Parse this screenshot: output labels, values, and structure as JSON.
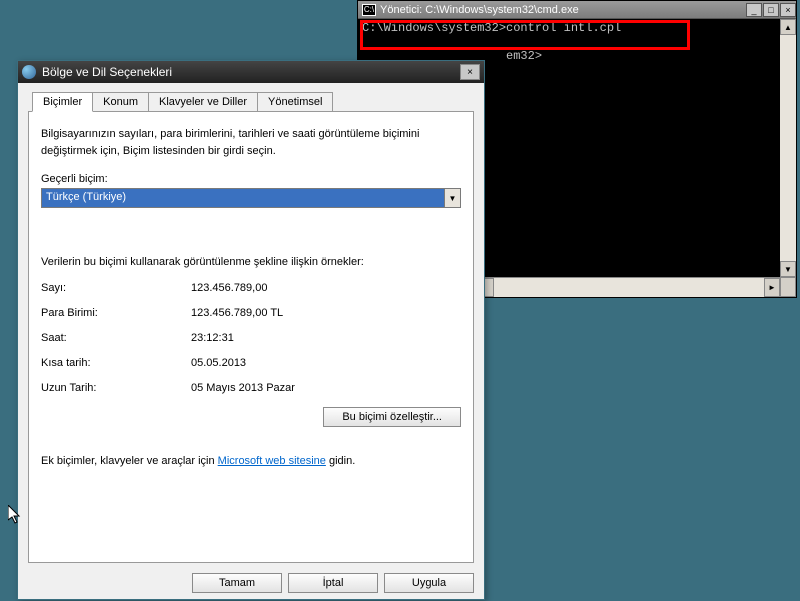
{
  "cmd": {
    "title": "Yönetici: C:\\Windows\\system32\\cmd.exe",
    "line1": "C:\\Windows\\system32>control intl.cpl",
    "line2_fragment": "em32>"
  },
  "dialog": {
    "title": "Bölge ve Dil Seçenekleri",
    "tabs": {
      "formats": "Biçimler",
      "location": "Konum",
      "keyboards": "Klavyeler ve Diller",
      "admin": "Yönetimsel"
    },
    "description": "Bilgisayarınızın sayıları, para birimlerini, tarihleri ve saati görüntüleme biçimini değiştirmek için, Biçim listesinden bir girdi seçin.",
    "current_format_label": "Geçerli biçim:",
    "current_format_value": "Türkçe (Türkiye)",
    "examples_label": "Verilerin bu biçimi kullanarak görüntülenme şekline ilişkin örnekler:",
    "rows": {
      "number_label": "Sayı:",
      "number_value": "123.456.789,00",
      "currency_label": "Para Birimi:",
      "currency_value": "123.456.789,00 TL",
      "time_label": "Saat:",
      "time_value": "23:12:31",
      "shortdate_label": "Kısa tarih:",
      "shortdate_value": "05.05.2013",
      "longdate_label": "Uzun Tarih:",
      "longdate_value": "05 Mayıs 2013 Pazar"
    },
    "customize_button": "Bu biçimi özelleştir...",
    "footer_pre": "Ek biçimler, klavyeler ve araçlar için ",
    "footer_link": "Microsoft web sitesine",
    "footer_post": " gidin.",
    "ok": "Tamam",
    "cancel": "İptal",
    "apply": "Uygula"
  }
}
